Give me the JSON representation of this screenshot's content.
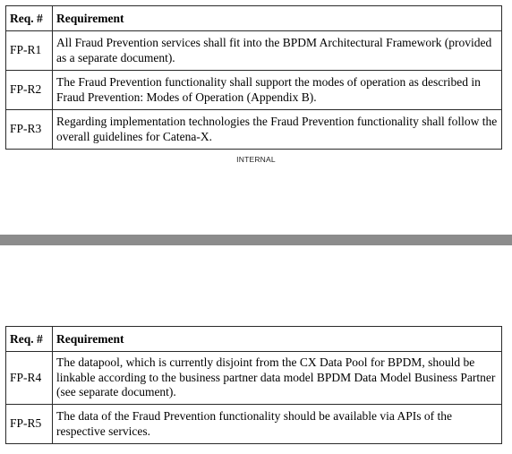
{
  "table1": {
    "header": {
      "id": "Req. #",
      "text": "Requirement"
    },
    "rows": [
      {
        "id": "FP-R1",
        "text": "All Fraud Prevention services shall fit into the BPDM Architectural Framework (provided as a separate document)."
      },
      {
        "id": "FP-R2",
        "text": "The Fraud Prevention functionality shall support the modes of operation as described in Fraud Prevention: Modes of Operation (Appendix B)."
      },
      {
        "id": "FP-R3",
        "text": "Regarding implementation technologies the Fraud Prevention functionality shall follow the overall guidelines for Catena-X."
      }
    ]
  },
  "footer_label": "INTERNAL",
  "table2": {
    "header": {
      "id": "Req. #",
      "text": "Requirement"
    },
    "rows": [
      {
        "id": "FP-R4",
        "text": "The datapool, which is currently disjoint from the CX Data Pool for BPDM, should be linkable according to the business partner data model BPDM Data Model Business Partner (see separate document)."
      },
      {
        "id": "FP-R5",
        "text": "The data of the Fraud Prevention functionality should be available via APIs of the respective services."
      }
    ]
  },
  "colors": {
    "separator": "#8c8c8c",
    "border": "#2a2a2a"
  }
}
